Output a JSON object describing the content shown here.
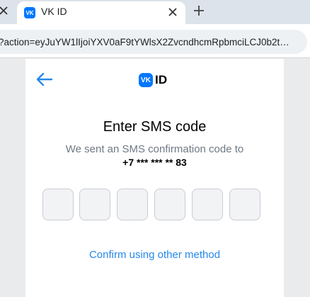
{
  "browser": {
    "tab": {
      "favicon_label": "VK",
      "title": "VK ID"
    },
    "address": {
      "url": "?action=eyJuYW1lIjoiYXV0aF9tYWlsX2ZvcndhcmRpbmciLCJ0b2t…"
    }
  },
  "auth": {
    "logo": {
      "mark": "VK",
      "text": "ID"
    },
    "title": "Enter SMS code",
    "subtitle": "We sent an SMS confirmation code to",
    "phone": "+7 *** *** ** 83",
    "code_cells": [
      "",
      "",
      "",
      "",
      "",
      ""
    ],
    "alt_method_label": "Confirm using other method"
  },
  "colors": {
    "accent": "#0077ff",
    "link": "#2688eb",
    "muted_text": "#6f7985"
  }
}
